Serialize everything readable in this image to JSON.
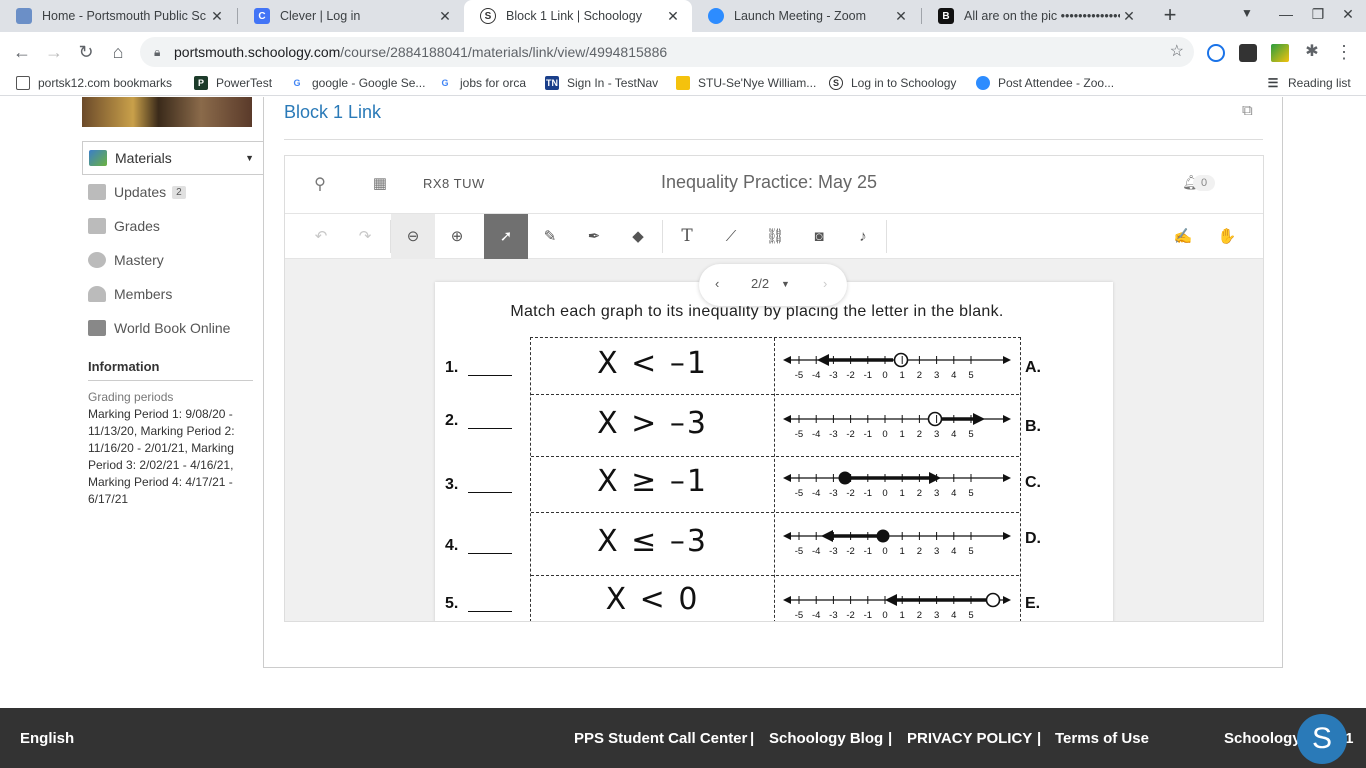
{
  "browser": {
    "tabs": [
      {
        "title": "Home - Portsmouth Public Sc",
        "close": "✕",
        "icon": "portsmouth-icon"
      },
      {
        "title": "Clever | Log in",
        "close": "✕",
        "icon": "clever-icon"
      },
      {
        "title": "Block 1 Link | Schoology",
        "close": "✕",
        "icon": "schoology-icon"
      },
      {
        "title": "Launch Meeting - Zoom",
        "close": "✕",
        "icon": "zoom-icon"
      },
      {
        "title": "All are on the pic ••••••••••••••••",
        "close": "✕",
        "icon": "brainly-icon"
      }
    ],
    "url_host": "portsmouth.schoology.com",
    "url_path": "/course/2884188041/materials/link/view/4994815886",
    "bookmarks": [
      {
        "label": "portsk12.com bookmarks",
        "icon": "folder-icon"
      },
      {
        "label": "PowerTest",
        "icon": "powertest-icon"
      },
      {
        "label": "google - Google Se...",
        "icon": "google-icon"
      },
      {
        "label": "jobs for orca",
        "icon": "google-icon"
      },
      {
        "label": "Sign In - TestNav",
        "icon": "testnav-icon"
      },
      {
        "label": "STU-Se'Nye William...",
        "icon": "folder-icon"
      },
      {
        "label": "Log in to Schoology",
        "icon": "schoology-icon"
      },
      {
        "label": "Post Attendee - Zoo...",
        "icon": "zoom-icon"
      }
    ],
    "reading_list": "Reading list"
  },
  "sidebar": {
    "items": [
      {
        "label": "Materials",
        "active": true
      },
      {
        "label": "Updates",
        "badge": "2"
      },
      {
        "label": "Grades"
      },
      {
        "label": "Mastery"
      },
      {
        "label": "Members"
      },
      {
        "label": "World Book Online"
      }
    ],
    "info_heading": "Information",
    "grading_heading": "Grading periods",
    "grading_text": "Marking Period 1: 9/08/20 - 11/13/20, Marking Period 2: 11/16/20 - 2/01/21, Marking Period 3: 2/02/21 - 4/16/21, Marking Period 4: 4/17/21 - 6/17/21"
  },
  "main": {
    "title": "Block 1 Link"
  },
  "viewer": {
    "code": "RX8 TUW",
    "doc_title": "Inequality Practice: May 25",
    "notify_count": "0",
    "pager": "2/2",
    "worksheet": {
      "instruction": "Match each graph to its inequality by placing the letter in the blank.",
      "rows": [
        {
          "num": "1.",
          "inequality": "X < –1",
          "letter": "A."
        },
        {
          "num": "2.",
          "inequality": "X > –3",
          "letter": "B."
        },
        {
          "num": "3.",
          "inequality": "X ≥ –1",
          "letter": "C."
        },
        {
          "num": "4.",
          "inequality": "X ≤ –3",
          "letter": "D."
        },
        {
          "num": "5.",
          "inequality": "X < 0",
          "letter": "E."
        }
      ],
      "tick_labels": [
        "-5",
        "-4",
        "-3",
        "-2",
        "-1",
        "0",
        "1",
        "2",
        "3",
        "4",
        "5"
      ]
    }
  },
  "footer": {
    "language": "English",
    "links": [
      "PPS Student Call Center",
      "|",
      "Schoology Blog",
      "|",
      "PRIVACY POLICY",
      "|",
      "Terms of Use"
    ],
    "brand": "Schoology © 2021",
    "fab_letter": "S"
  },
  "colors": {
    "link": "#2a7ab8",
    "footer_bg": "#333333",
    "selected_tool": "#707070"
  }
}
